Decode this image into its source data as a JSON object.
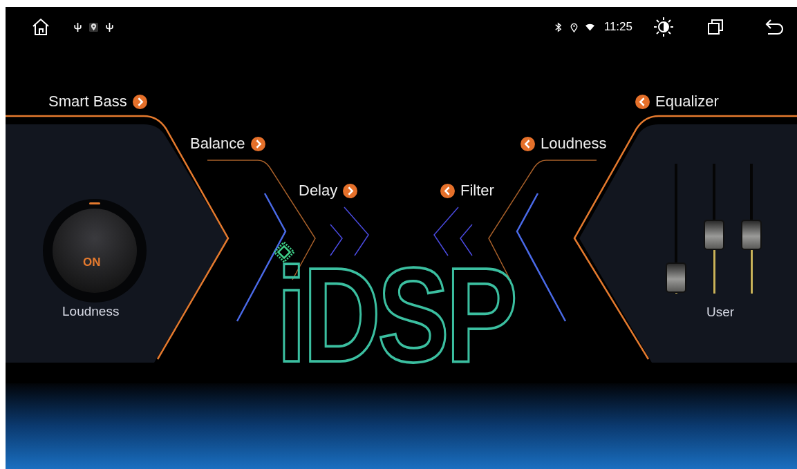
{
  "status_bar": {
    "time": "11:25"
  },
  "menu_items": [
    {
      "label": "Smart Bass",
      "kind": "forward"
    },
    {
      "label": "Balance",
      "kind": "forward"
    },
    {
      "label": "Delay",
      "kind": "forward"
    },
    {
      "label": "Filter",
      "kind": "backward"
    },
    {
      "label": "Loudness",
      "kind": "backward"
    },
    {
      "label": "Equalizer",
      "kind": "backward"
    }
  ],
  "loudness_panel": {
    "switch_text": "ON",
    "on": true,
    "label": "Loudness"
  },
  "logo": "iDSP",
  "equalizer_panel": {
    "label": "User",
    "sliders": [
      {
        "level": 0.12
      },
      {
        "level": 0.45
      },
      {
        "level": 0.45
      }
    ]
  }
}
